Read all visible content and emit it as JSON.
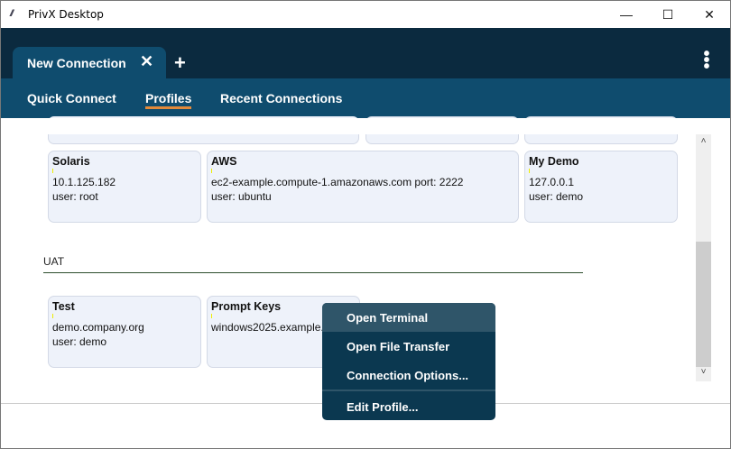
{
  "window": {
    "title": "PrivX Desktop",
    "minimize": "—",
    "maximize": "☐",
    "close": "✕"
  },
  "tabs": [
    {
      "label": "New Connection",
      "close": "✕"
    }
  ],
  "add_tab": "+",
  "menu_icon": "⋮",
  "nav": [
    "Quick Connect",
    "Profiles",
    "Recent Connections"
  ],
  "active_nav": "Profiles",
  "profiles": [
    {
      "name": "Solaris",
      "host": "10.1.125.182",
      "user": "user: root"
    },
    {
      "name": "AWS",
      "host": "ec2-example.compute-1.amazonaws.com port: 2222",
      "user": "user: ubuntu"
    },
    {
      "name": "My Demo",
      "host": "127.0.0.1",
      "user": "user: demo"
    }
  ],
  "group": "UAT",
  "uat_profiles": [
    {
      "name": "Test",
      "host": "demo.company.org",
      "user": "user: demo"
    },
    {
      "name": "Prompt Keys",
      "host": "windows2025.example.com",
      "user": ""
    }
  ],
  "context_menu": [
    "Open Terminal",
    "Open File Transfer",
    "Connection Options...",
    "Edit Profile..."
  ],
  "scroll": {
    "up": "˄",
    "down": "˅"
  }
}
